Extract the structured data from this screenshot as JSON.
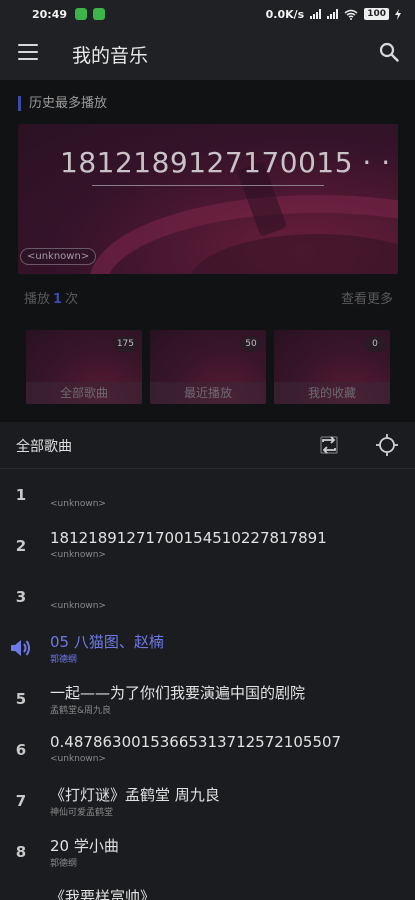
{
  "status_bar": {
    "time": "20:49",
    "speed": "0.0K/s",
    "battery": "100"
  },
  "app_bar": {
    "title": "我的音乐"
  },
  "history": {
    "label": "历史最多播放",
    "banner_title": "1812189127170015 · ·",
    "banner_tag": "<unknown>",
    "play_prefix": "播放",
    "play_count": "1",
    "play_suffix": "次",
    "see_more": "查看更多"
  },
  "tiles": [
    {
      "label": "全部歌曲",
      "count": "175"
    },
    {
      "label": "最近播放",
      "count": "50"
    },
    {
      "label": "我的收藏",
      "count": "0"
    }
  ],
  "list": {
    "title": "全部歌曲"
  },
  "songs": [
    {
      "num": "1",
      "title": "",
      "artist": "<unknown>"
    },
    {
      "num": "2",
      "title": "181218912717001545102278178​91",
      "artist": "<unknown>"
    },
    {
      "num": "3",
      "title": "",
      "artist": "<unknown>"
    },
    {
      "num": "",
      "title": "05 八猫图、赵楠",
      "artist": "郭德纲",
      "playing": true
    },
    {
      "num": "5",
      "title": "一起——为了你们我要演遍中国的剧院",
      "artist": "孟鹤堂&周九良"
    },
    {
      "num": "6",
      "title": "0.487863001536653137125721​05507",
      "artist": "<unknown>"
    },
    {
      "num": "7",
      "title": "《打灯谜》孟鹤堂 周九良",
      "artist": "神仙可爱孟鹤堂"
    },
    {
      "num": "8",
      "title": "20 学小曲",
      "artist": "郭德纲"
    },
    {
      "num": "",
      "title": "《我要样富帅》",
      "artist": ""
    }
  ],
  "colors": {
    "accent": "#3d4aa6",
    "playing": "#6f79e6",
    "background": "#1a1c20"
  }
}
